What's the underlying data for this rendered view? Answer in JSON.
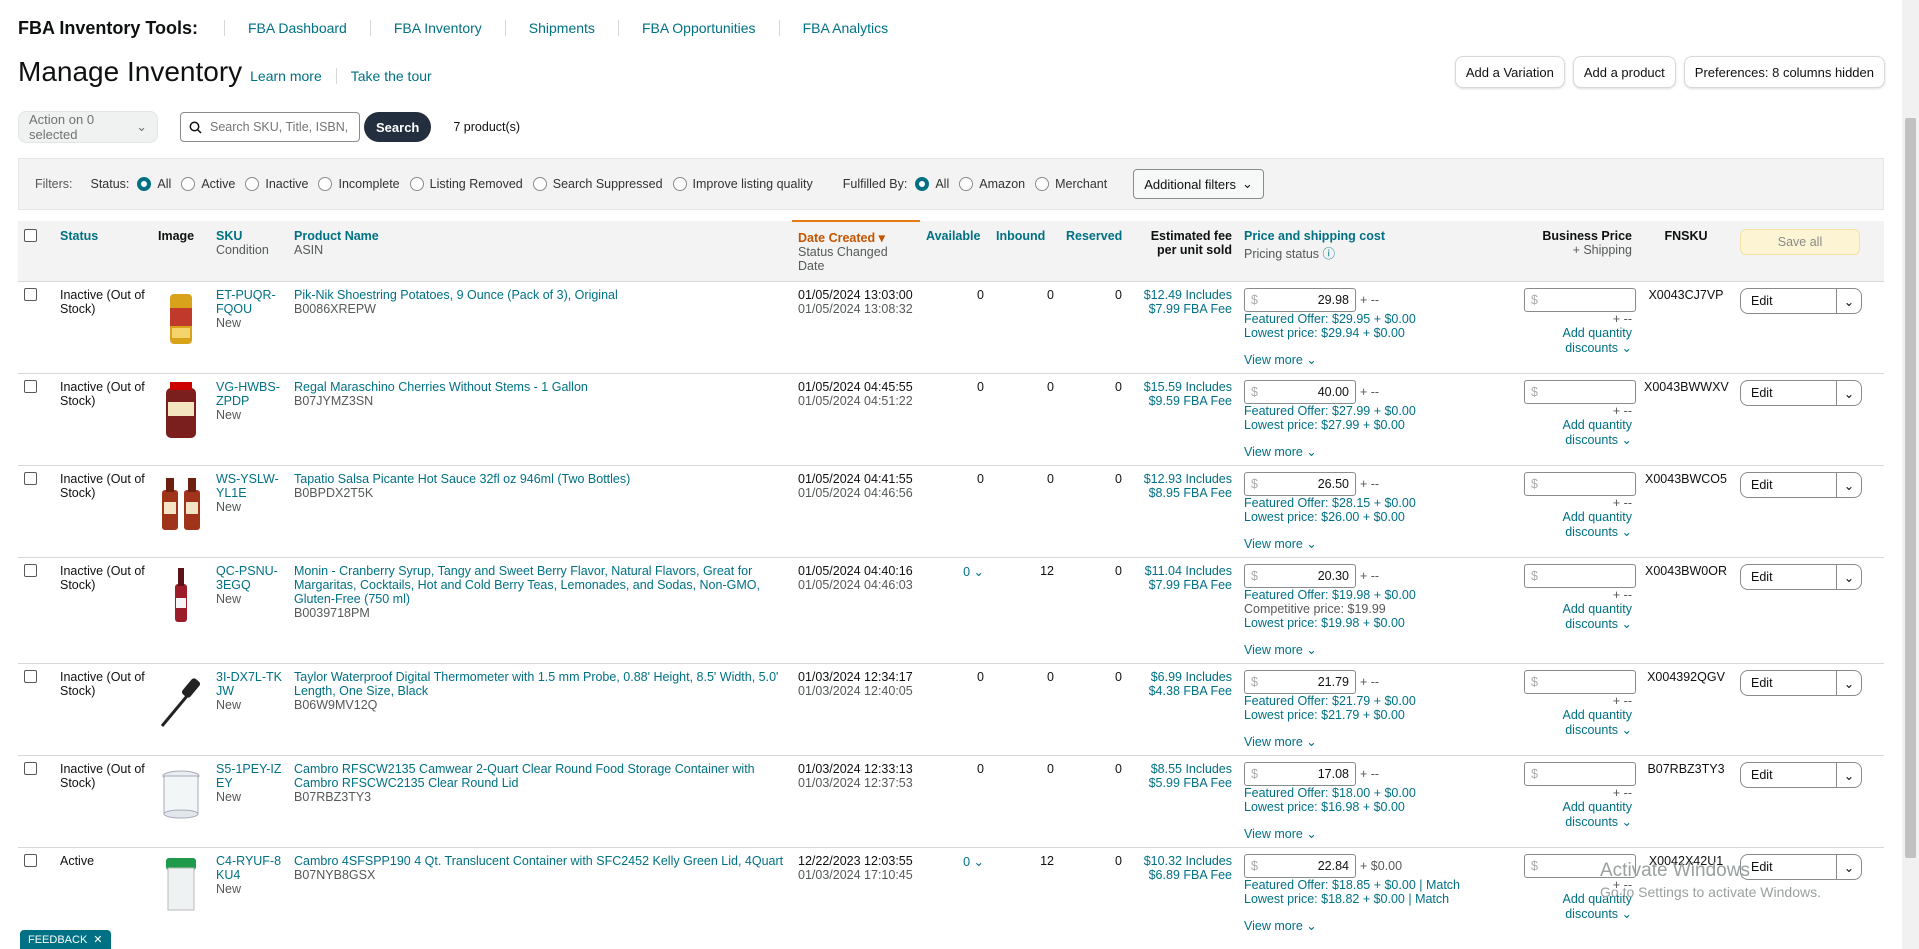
{
  "nav": {
    "brand": "FBA Inventory Tools:",
    "links": [
      "FBA Dashboard",
      "FBA Inventory",
      "Shipments",
      "FBA Opportunities",
      "FBA Analytics"
    ]
  },
  "header": {
    "title": "Manage Inventory",
    "learn_more": "Learn more",
    "take_tour": "Take the tour",
    "buttons": [
      "Add a Variation",
      "Add a product",
      "Preferences: 8 columns hidden"
    ]
  },
  "actions": {
    "action_label": "Action on 0 selected",
    "search_placeholder": "Search SKU, Title, ISBN,",
    "search_button": "Search",
    "product_count": "7 product(s)"
  },
  "filters": {
    "label": "Filters:",
    "status_label": "Status:",
    "status_options": [
      "All",
      "Active",
      "Inactive",
      "Incomplete",
      "Listing Removed",
      "Search Suppressed",
      "Improve listing quality"
    ],
    "status_selected": "All",
    "fulfilled_label": "Fulfilled By:",
    "fulfilled_options": [
      "All",
      "Amazon",
      "Merchant"
    ],
    "fulfilled_selected": "All",
    "additional": "Additional filters"
  },
  "columns": {
    "status": "Status",
    "image": "Image",
    "sku": "SKU",
    "sku_sub": "Condition",
    "product_name": "Product Name",
    "product_sub": "ASIN",
    "date_created": "Date Created",
    "date_sub": "Status Changed Date",
    "available": "Available",
    "inbound": "Inbound",
    "reserved": "Reserved",
    "fee": "Estimated fee per unit sold",
    "price": "Price and shipping cost",
    "price_sub": "Pricing status",
    "business_price": "Business Price",
    "business_sub": "+ Shipping",
    "fnsku": "FNSKU",
    "save_all": "Save all"
  },
  "rows": [
    {
      "status": "Inactive (Out of Stock)",
      "sku": "ET-PUQR-FQOU",
      "condition": "New",
      "name": "Pik-Nik Shoestring Potatoes, 9 Ounce (Pack of 3), Original",
      "asin": "B0086XREPW",
      "created": "01/05/2024 13:03:00",
      "changed": "01/05/2024 13:08:32",
      "available": "0",
      "inbound": "0",
      "reserved": "0",
      "fee": "$12.49 Includes",
      "fba_fee": "$7.99 FBA Fee",
      "price": "29.98",
      "price_suffix": "+ --",
      "line1": "Featured Offer: $29.95 + $0.00",
      "line2": "Lowest price: $29.94 + $0.00",
      "fnsku": "X0043CJ7VP",
      "img": "can"
    },
    {
      "status": "Inactive (Out of Stock)",
      "sku": "VG-HWBS-ZPDP",
      "condition": "New",
      "name": "Regal Maraschino Cherries Without Stems - 1 Gallon",
      "asin": "B07JYMZ3SN",
      "created": "01/05/2024 04:45:55",
      "changed": "01/05/2024 04:51:22",
      "available": "0",
      "inbound": "0",
      "reserved": "0",
      "fee": "$15.59 Includes",
      "fba_fee": "$9.59 FBA Fee",
      "price": "40.00",
      "price_suffix": "+ --",
      "line1": "Featured Offer: $27.99 + $0.00",
      "line2": "Lowest price: $27.99 + $0.00",
      "fnsku": "X0043BWWXV",
      "img": "jar"
    },
    {
      "status": "Inactive (Out of Stock)",
      "sku": "WS-YSLW-YL1E",
      "condition": "New",
      "name": "Tapatio Salsa Picante Hot Sauce 32fl oz 946ml (Two Bottles)",
      "asin": "B0BPDX2T5K",
      "created": "01/05/2024 04:41:55",
      "changed": "01/05/2024 04:46:56",
      "available": "0",
      "inbound": "0",
      "reserved": "0",
      "fee": "$12.93 Includes",
      "fba_fee": "$8.95 FBA Fee",
      "price": "26.50",
      "price_suffix": "+ --",
      "line1": "Featured Offer: $28.15 + $0.00",
      "line2": "Lowest price: $26.00 + $0.00",
      "fnsku": "X0043BWCO5",
      "img": "bottles"
    },
    {
      "status": "Inactive (Out of Stock)",
      "sku": "QC-PSNU-3EGQ",
      "condition": "New",
      "name": "Monin - Cranberry Syrup, Tangy and Sweet Berry Flavor, Natural Flavors, Great for Margaritas, Cocktails, Hot and Cold Berry Teas, Lemonades, and Sodas, Non-GMO, Gluten-Free (750 ml)",
      "asin": "B0039718PM",
      "created": "01/05/2024 04:40:16",
      "changed": "01/05/2024 04:46:03",
      "available": "0",
      "available_dd": true,
      "inbound": "12",
      "reserved": "0",
      "fee": "$11.04 Includes",
      "fba_fee": "$7.99 FBA Fee",
      "price": "20.30",
      "price_suffix": "+ --",
      "line1": "Featured Offer: $19.98 + $0.00",
      "line_mid": "Competitive price: $19.99",
      "line2": "Lowest price: $19.98 + $0.00",
      "fnsku": "X0043BW0OR",
      "img": "syrup"
    },
    {
      "status": "Inactive (Out of Stock)",
      "sku": "3I-DX7L-TKJW",
      "condition": "New",
      "name": "Taylor Waterproof Digital Thermometer with 1.5 mm Probe, 0.88' Height, 8.5' Width, 5.0' Length, One Size, Black",
      "asin": "B06W9MV12Q",
      "created": "01/03/2024 12:34:17",
      "changed": "01/03/2024 12:40:05",
      "available": "0",
      "inbound": "0",
      "reserved": "0",
      "fee": "$6.99 Includes",
      "fba_fee": "$4.38 FBA Fee",
      "price": "21.79",
      "price_suffix": "+ --",
      "line1": "Featured Offer: $21.79 + $0.00",
      "line2": "Lowest price: $21.79 + $0.00",
      "fnsku": "X004392QGV",
      "img": "thermo"
    },
    {
      "status": "Inactive (Out of Stock)",
      "sku": "S5-1PEY-IZEY",
      "condition": "New",
      "name": "Cambro RFSCW2135 Camwear 2-Quart Clear Round Food Storage Container with Cambro RFSCWC2135 Clear Round Lid",
      "asin": "B07RBZ3TY3",
      "created": "01/03/2024 12:33:13",
      "changed": "01/03/2024 12:37:53",
      "available": "0",
      "inbound": "0",
      "reserved": "0",
      "fee": "$8.55 Includes",
      "fba_fee": "$5.99 FBA Fee",
      "price": "17.08",
      "price_suffix": "+ --",
      "line1": "Featured Offer: $18.00 + $0.00",
      "line2": "Lowest price: $16.98 + $0.00",
      "fnsku": "B07RBZ3TY3",
      "img": "container"
    },
    {
      "status": "Active",
      "sku": "C4-RYUF-8KU4",
      "condition": "New",
      "name": "Cambro 4SFSPP190 4 Qt. Translucent Container with SFC2452 Kelly Green Lid, 4Quart",
      "asin": "B07NYB8GSX",
      "created": "12/22/2023 12:03:55",
      "changed": "01/03/2024 17:10:45",
      "available": "0",
      "available_dd": true,
      "inbound": "12",
      "reserved": "0",
      "fee": "$10.32 Includes",
      "fba_fee": "$6.89 FBA Fee",
      "price": "22.84",
      "price_suffix": "+ $0.00",
      "line1": "Featured Offer: $18.85 + $0.00 | Match",
      "line2": "Lowest price: $18.82 + $0.00 | Match",
      "fnsku": "X0042X42U1",
      "img": "green"
    }
  ],
  "row_common": {
    "view_more": "View more",
    "currency": "$",
    "bp_sub": "+ --",
    "aqd1": "Add quantity",
    "aqd2": "discounts",
    "edit": "Edit"
  },
  "feedback": "FEEDBACK",
  "watermark": {
    "title": "Activate Windows",
    "sub": "Go to Settings to activate Windows."
  },
  "colors": {
    "link": "#007185",
    "sort": "#c45500",
    "search_btn": "#232f3e"
  }
}
